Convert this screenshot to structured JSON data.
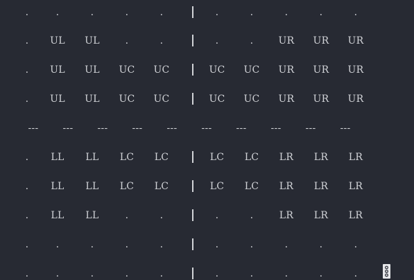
{
  "terminal": {
    "rows": [
      [
        ".",
        ".",
        ".",
        ".",
        ".",
        "|",
        ".",
        ".",
        ".",
        ".",
        "."
      ],
      [
        ".",
        "UL",
        "UL",
        ".",
        ".",
        "|",
        ".",
        ".",
        "UR",
        "UR",
        "UR"
      ],
      [
        ".",
        "UL",
        "UL",
        "UC",
        "UC",
        "|",
        "UC",
        "UC",
        "UR",
        "UR",
        "UR"
      ],
      [
        ".",
        "UL",
        "UL",
        "UC",
        "UC",
        "|",
        "UC",
        "UC",
        "UR",
        "UR",
        "UR"
      ],
      [
        "---",
        "---",
        "---",
        "---",
        "---",
        "---",
        "---",
        "---",
        "---",
        "---"
      ],
      [
        ".",
        "LL",
        "LL",
        "LC",
        "LC",
        "|",
        "LC",
        "LC",
        "LR",
        "LR",
        "LR"
      ],
      [
        ".",
        "LL",
        "LL",
        "LC",
        "LC",
        "|",
        "LC",
        "LC",
        "LR",
        "LR",
        "LR"
      ],
      [
        ".",
        "LL",
        "LL",
        ".",
        ".",
        "|",
        ".",
        ".",
        "LR",
        "LR",
        "LR"
      ],
      [
        ".",
        ".",
        ".",
        ".",
        ".",
        "|",
        ".",
        ".",
        ".",
        ".",
        "."
      ],
      [
        ".",
        ".",
        ".",
        ".",
        ".",
        "|",
        ".",
        ".",
        ".",
        ".",
        "."
      ]
    ]
  },
  "colors": {
    "background": "#272a33",
    "text": "#d2d4d8"
  },
  "icons": {
    "scroll_indicator": "scroll-indicator-icon"
  }
}
